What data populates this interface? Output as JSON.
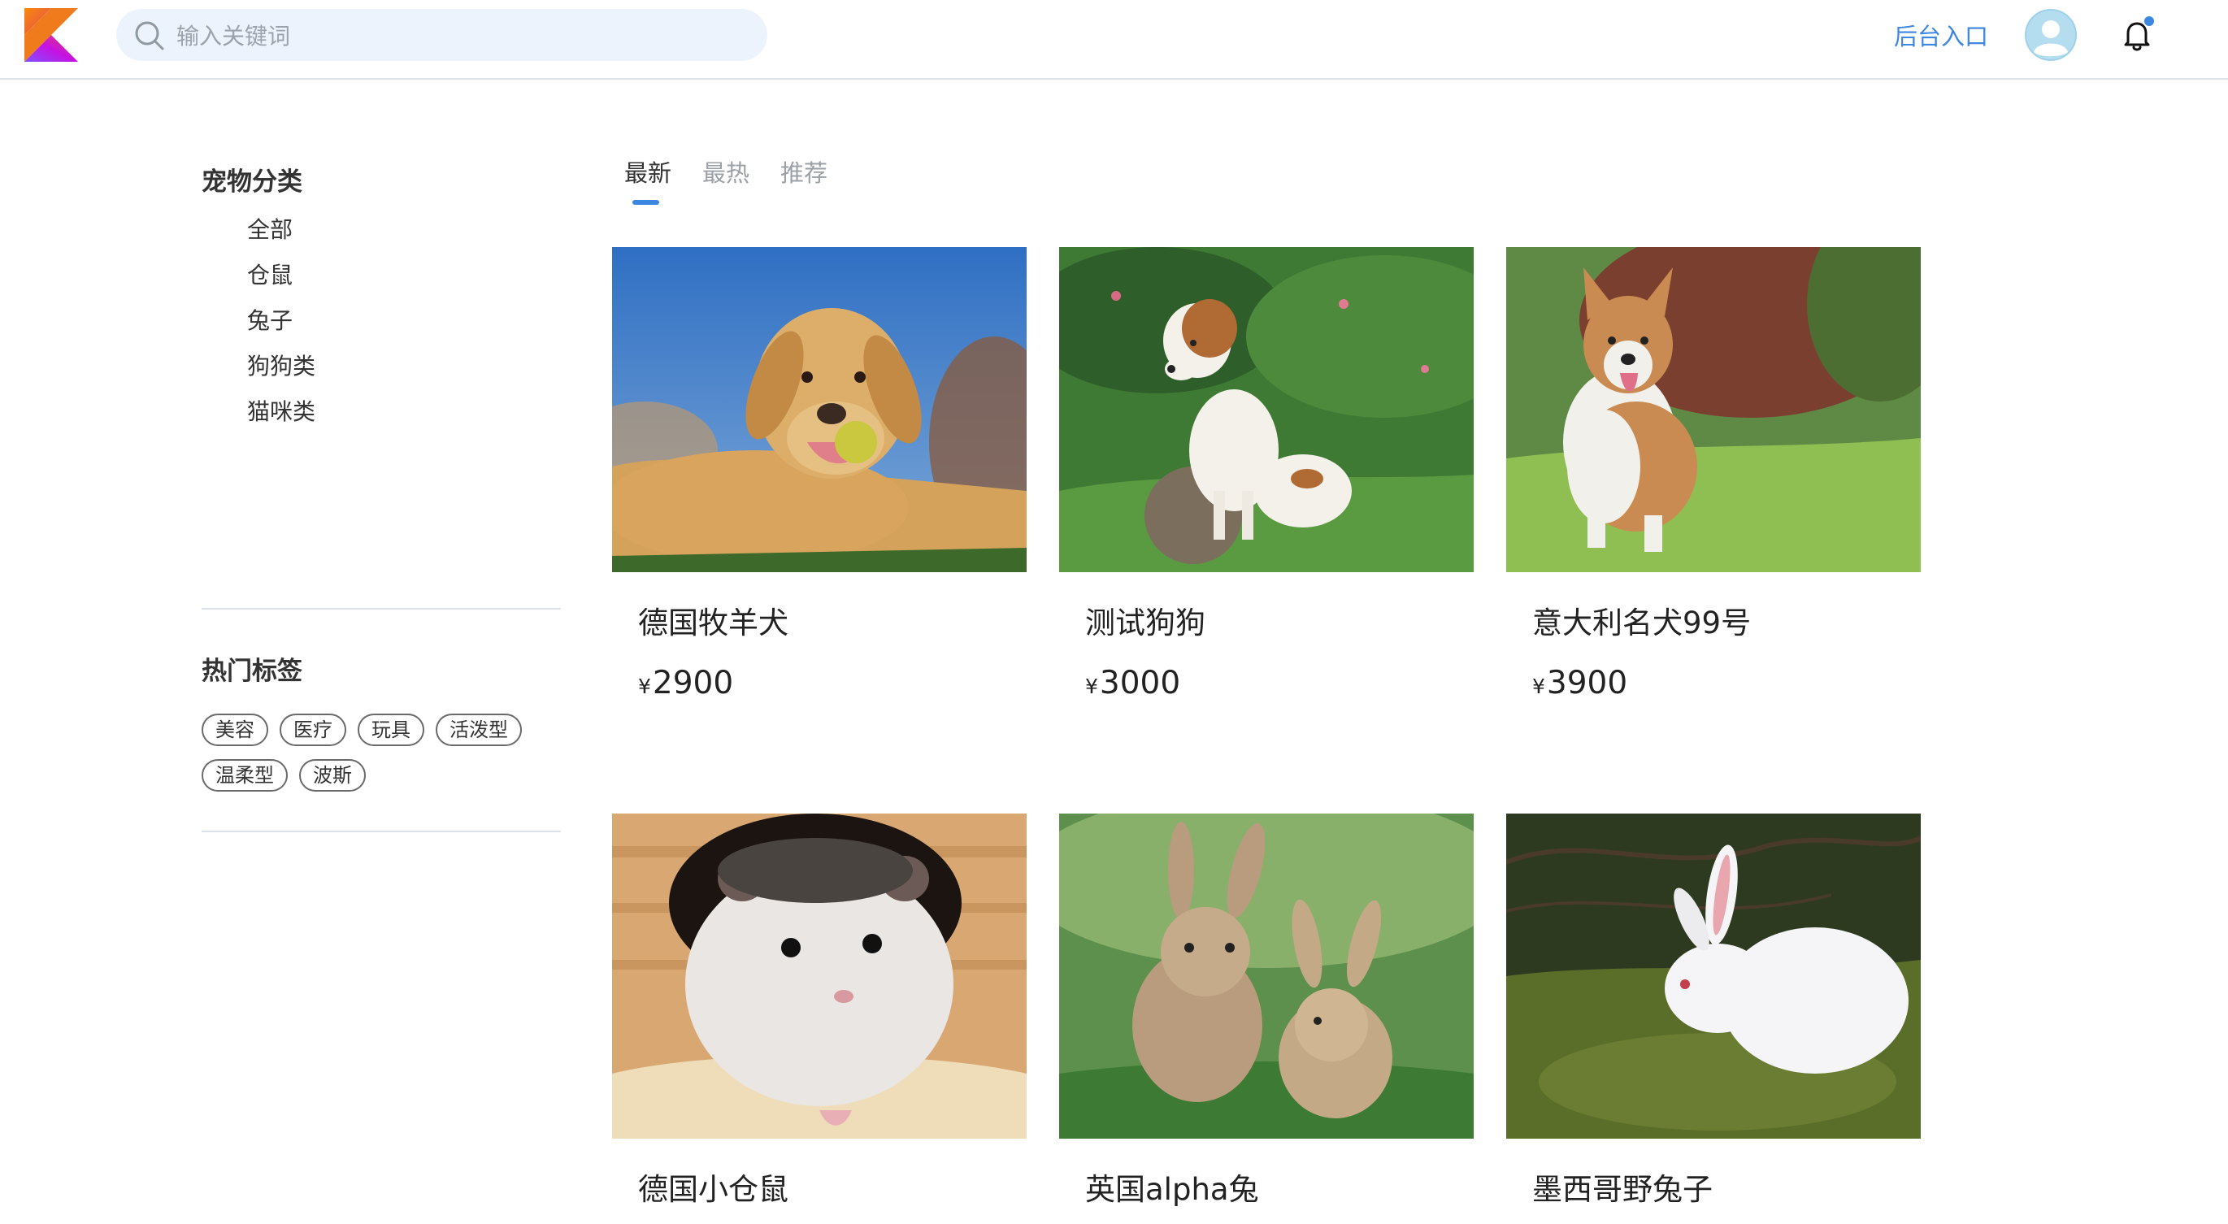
{
  "header": {
    "logo": "kotlin-logo",
    "search_placeholder": "输入关键词",
    "admin_link": "后台入口",
    "avatar_icon": "user-avatar-icon",
    "bell_icon": "bell-icon",
    "notification_dot_color": "#3d86e1"
  },
  "sidebar": {
    "categories_title": "宠物分类",
    "categories": [
      "全部",
      "仓鼠",
      "兔子",
      "狗狗类",
      "猫咪类"
    ],
    "tags_title": "热门标签",
    "tags": [
      "美容",
      "医疗",
      "玩具",
      "活泼型",
      "温柔型",
      "波斯"
    ]
  },
  "tabs": [
    {
      "label": "最新",
      "active": true
    },
    {
      "label": "最热",
      "active": false
    },
    {
      "label": "推荐",
      "active": false
    }
  ],
  "currency_symbol": "¥",
  "products": [
    {
      "name": "德国牧羊犬",
      "price": "2900",
      "image": "golden-labrador-photo"
    },
    {
      "name": "测试狗狗",
      "price": "3000",
      "image": "puppy-on-grass-photo"
    },
    {
      "name": "意大利名犬99号",
      "price": "3900",
      "image": "corgi-running-photo"
    },
    {
      "name": "德国小仓鼠",
      "image": "white-hamster-photo"
    },
    {
      "name": "英国alpha兔",
      "image": "two-brown-rabbits-photo"
    },
    {
      "name": "墨西哥野兔子",
      "image": "white-rabbit-on-moss-photo"
    }
  ],
  "colors": {
    "accent": "#3d86e1",
    "search_bg": "#edf3fc",
    "divider": "#dbe2ea"
  }
}
